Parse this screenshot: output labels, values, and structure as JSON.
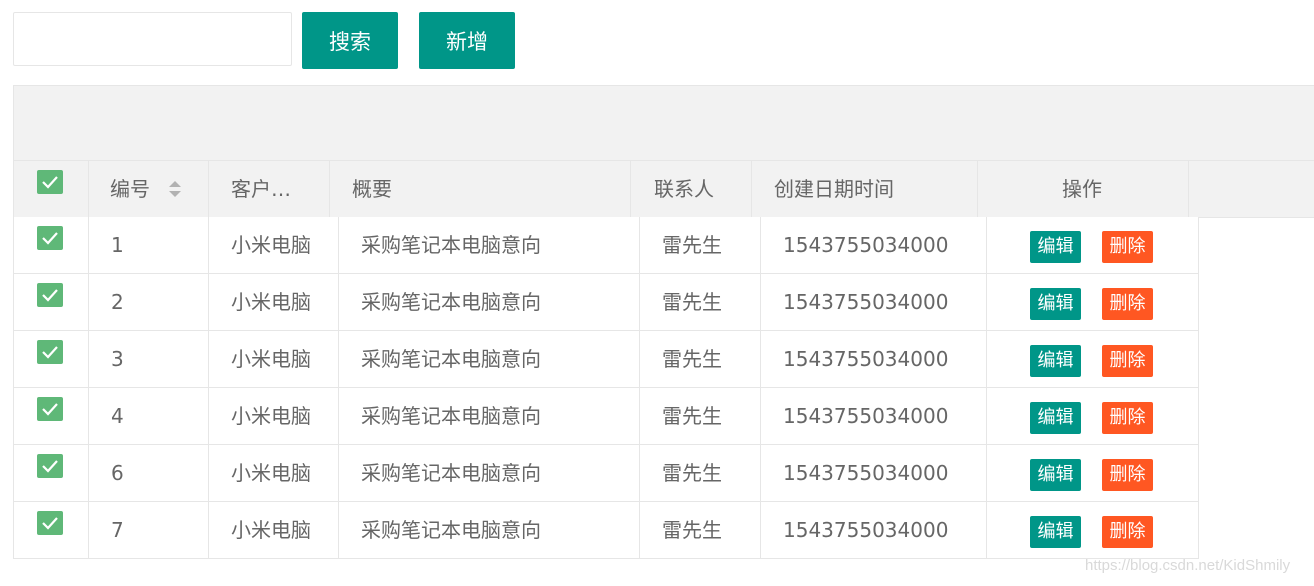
{
  "search": {
    "value": "",
    "button_label": "搜索"
  },
  "add_button_label": "新增",
  "table": {
    "columns": {
      "id": "编号",
      "customer": "客户…",
      "summary": "概要",
      "contact": "联系人",
      "created": "创建日期时间",
      "actions": "操作"
    },
    "row_actions": {
      "edit": "编辑",
      "delete": "删除"
    },
    "rows": [
      {
        "checked": true,
        "id": "1",
        "customer": "小米电脑",
        "summary": "采购笔记本电脑意向",
        "contact": "雷先生",
        "created": "1543755034000"
      },
      {
        "checked": true,
        "id": "2",
        "customer": "小米电脑",
        "summary": "采购笔记本电脑意向",
        "contact": "雷先生",
        "created": "1543755034000"
      },
      {
        "checked": true,
        "id": "3",
        "customer": "小米电脑",
        "summary": "采购笔记本电脑意向",
        "contact": "雷先生",
        "created": "1543755034000"
      },
      {
        "checked": true,
        "id": "4",
        "customer": "小米电脑",
        "summary": "采购笔记本电脑意向",
        "contact": "雷先生",
        "created": "1543755034000"
      },
      {
        "checked": true,
        "id": "6",
        "customer": "小米电脑",
        "summary": "采购笔记本电脑意向",
        "contact": "雷先生",
        "created": "1543755034000"
      },
      {
        "checked": true,
        "id": "7",
        "customer": "小米电脑",
        "summary": "采购笔记本电脑意向",
        "contact": "雷先生",
        "created": "1543755034000"
      }
    ]
  },
  "header_checkbox_checked": true,
  "colors": {
    "primary": "#009688",
    "danger": "#ff5722",
    "checkbox": "#5fb878"
  },
  "watermark": "https://blog.csdn.net/KidShmily"
}
